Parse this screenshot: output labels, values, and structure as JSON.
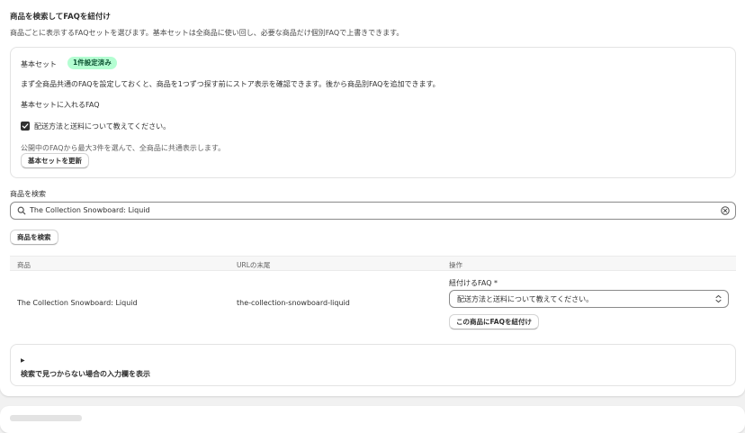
{
  "section": {
    "title": "商品を検索してFAQを紐付け",
    "subtitle": "商品ごとに表示するFAQセットを選びます。基本セットは全商品に使い回し、必要な商品だけ個別FAQで上書きできます。"
  },
  "base_set": {
    "label": "基本セット",
    "badge": "1件設定済み",
    "description": "まず全商品共通のFAQを設定しておくと、商品を1つずつ探す前にストア表示を確認できます。後から商品別FAQを追加できます。",
    "faq_label": "基本セットに入れるFAQ",
    "faq_item": {
      "label": "配送方法と送料について教えてください。",
      "checked": true
    },
    "hint": "公開中のFAQから最大3件を選んで、全商品に共通表示します。",
    "update_button": "基本セットを更新"
  },
  "search": {
    "label": "商品を検索",
    "value": "The Collection Snowboard: Liquid",
    "button": "商品を検索"
  },
  "table": {
    "headers": [
      "商品",
      "URLの末尾",
      "操作"
    ],
    "rows": [
      {
        "product": "The Collection Snowboard: Liquid",
        "handle": "the-collection-snowboard-liquid",
        "select_label": "紐付けるFAQ *",
        "select_value": "配送方法と送料について教えてください。",
        "action_button": "この商品にFAQを紐付け"
      }
    ]
  },
  "collapsible": {
    "toggle_glyph": "▶",
    "label": "検索で見つからない場合の入力欄を表示"
  },
  "colors": {
    "badge_bg": "#b4fed2",
    "badge_text": "#0c5132",
    "page_bg": "#f1f1f1"
  }
}
